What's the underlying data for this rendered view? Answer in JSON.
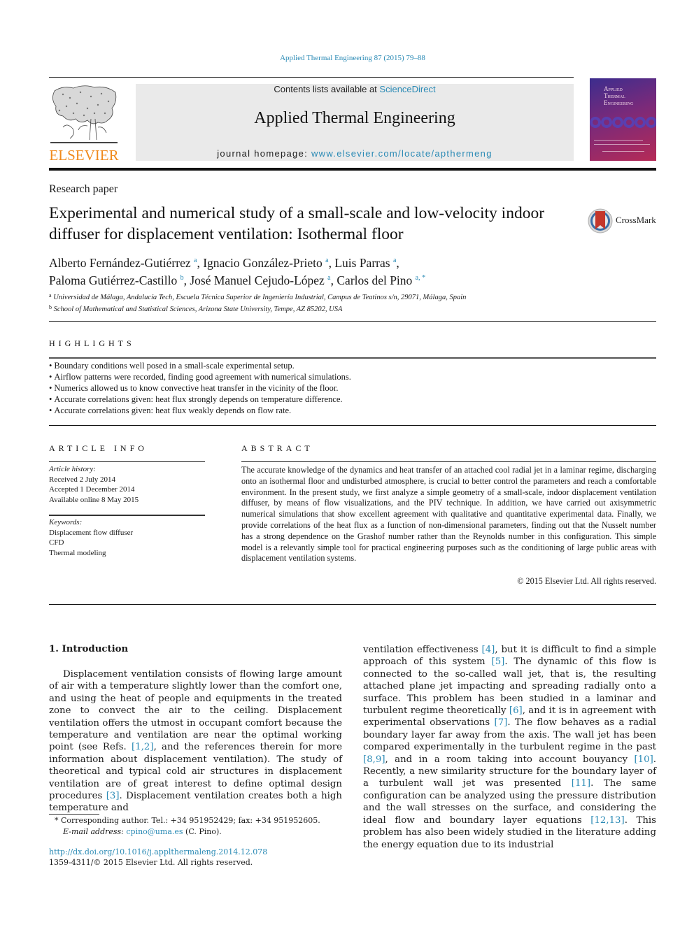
{
  "citation": "Applied Thermal Engineering 87 (2015) 79–88",
  "header": {
    "publisher_logo_word": "ELSEVIER",
    "contents_prefix": "Contents lists available at ",
    "contents_link": "ScienceDirect",
    "journal_name": "Applied Thermal Engineering",
    "homepage_prefix": "journal homepage: ",
    "homepage_link": "www.elsevier.com/locate/apthermeng",
    "cover_title_lines": [
      "Applied",
      "Thermal",
      "Engineering"
    ]
  },
  "article": {
    "type": "Research paper",
    "title": "Experimental and numerical study of a small-scale and low-velocity indoor diffuser for displacement ventilation: Isothermal floor",
    "crossmark_label": "CrossMark",
    "authors": [
      {
        "name": "Alberto Fernández-Gutiérrez",
        "aff": "a",
        "sep": ", "
      },
      {
        "name": "Ignacio González-Prieto",
        "aff": "a",
        "sep": ", "
      },
      {
        "name": "Luis Parras",
        "aff": "a",
        "sep": ","
      },
      {
        "name": "Paloma Gutiérrez-Castillo",
        "aff": "b",
        "sep": ", "
      },
      {
        "name": "José Manuel Cejudo-López",
        "aff": "a",
        "sep": ", "
      },
      {
        "name": "Carlos del Pino",
        "aff": "a, *",
        "sep": ""
      }
    ],
    "affiliations": [
      {
        "mark": "a",
        "text": "Universidad de Málaga, Andalucía Tech, Escuela Técnica Superior de Ingeniería Industrial, Campus de Teatinos s/n, 29071, Málaga, Spain"
      },
      {
        "mark": "b",
        "text": "School of Mathematical and Statistical Sciences, Arizona State University, Tempe, AZ 85202, USA"
      }
    ]
  },
  "highlights": {
    "heading": "HIGHLIGHTS",
    "items": [
      "Boundary conditions well posed in a small-scale experimental setup.",
      "Airflow patterns were recorded, finding good agreement with numerical simulations.",
      "Numerics allowed us to know convective heat transfer in the vicinity of the floor.",
      "Accurate correlations given: heat flux strongly depends on temperature difference.",
      "Accurate correlations given: heat flux weakly depends on flow rate."
    ]
  },
  "article_info": {
    "heading": "ARTICLE INFO",
    "history_label": "Article history:",
    "received": "Received 2 July 2014",
    "accepted": "Accepted 1 December 2014",
    "available": "Available online 8 May 2015",
    "keywords_label": "Keywords:",
    "keywords": [
      "Displacement flow diffuser",
      "CFD",
      "Thermal modeling"
    ]
  },
  "abstract": {
    "heading": "ABSTRACT",
    "text": "The accurate knowledge of the dynamics and heat transfer of an attached cool radial jet in a laminar regime, discharging onto an isothermal floor and undisturbed atmosphere, is crucial to better control the parameters and reach a comfortable environment. In the present study, we first analyze a simple geometry of a small-scale, indoor displacement ventilation diffuser, by means of flow visualizations, and the PIV technique. In addition, we have carried out axisymmetric numerical simulations that show excellent agreement with qualitative and quantitative experimental data. Finally, we provide correlations of the heat flux as a function of non-dimensional parameters, finding out that the Nusselt number has a strong dependence on the Grashof number rather than the Reynolds number in this configuration. This simple model is a relevantly simple tool for practical engineering purposes such as the conditioning of large public areas with displacement ventilation systems.",
    "copyright": "© 2015 Elsevier Ltd. All rights reserved."
  },
  "introduction": {
    "heading": "1.  Introduction",
    "left": [
      {
        "t": "Displacement ventilation consists of flowing large amount of air with a temperature slightly lower than the comfort one, and using the heat of people and equipments in the treated zone to convect the air to the ceiling. Displacement ventilation offers the utmost in occupant comfort because the temperature and ventilation are near the optimal working point (see Refs. "
      },
      {
        "ref": "[1,2]"
      },
      {
        "t": ", and the references therein for more information about displacement ventilation). The study of theoretical and typical cold air structures in displacement ventilation are of great interest to define optimal design procedures "
      },
      {
        "ref": "[3]"
      },
      {
        "t": ". Displacement ventilation creates both a high temperature and"
      }
    ],
    "right": [
      {
        "t": "ventilation effectiveness "
      },
      {
        "ref": "[4]"
      },
      {
        "t": ", but it is difficult to find a simple approach of this system "
      },
      {
        "ref": "[5]"
      },
      {
        "t": ". The dynamic of this flow is connected to the so-called wall jet, that is, the resulting attached plane jet impacting and spreading radially onto a surface. This problem has been studied in a laminar and turbulent regime theoretically "
      },
      {
        "ref": "[6]"
      },
      {
        "t": ", and it is in agreement with experimental observations "
      },
      {
        "ref": "[7]"
      },
      {
        "t": ". The flow behaves as a radial boundary layer far away from the axis. The wall jet has been compared experimentally in the turbulent regime in the past "
      },
      {
        "ref": "[8,9]"
      },
      {
        "t": ", and in a room taking into account bouyancy "
      },
      {
        "ref": "[10]"
      },
      {
        "t": ". Recently, a new similarity structure for the boundary layer of a turbulent wall jet was presented "
      },
      {
        "ref": "[11]"
      },
      {
        "t": ". The same configuration can be analyzed using the pressure distribution and the wall stresses on the surface, and considering the ideal flow and boundary layer equations "
      },
      {
        "ref": "[12,13]"
      },
      {
        "t": ". This problem has also been widely studied in the literature adding the energy equation due to its industrial"
      }
    ]
  },
  "footnote": {
    "star": "*",
    "corresponding": "Corresponding author. Tel.: +34 951952429; fax: +34 951952605.",
    "email_label": "E-mail address: ",
    "email": "cpino@uma.es",
    "email_suffix": " (C. Pino).",
    "doi": "http://dx.doi.org/10.1016/j.applthermaleng.2014.12.078",
    "issn": "1359-4311/© 2015 Elsevier Ltd. All rights reserved."
  },
  "colors": {
    "link": "#2a8ab5",
    "elsevier_orange": "#f08a1c",
    "banner_gray": "#eaeaea"
  }
}
